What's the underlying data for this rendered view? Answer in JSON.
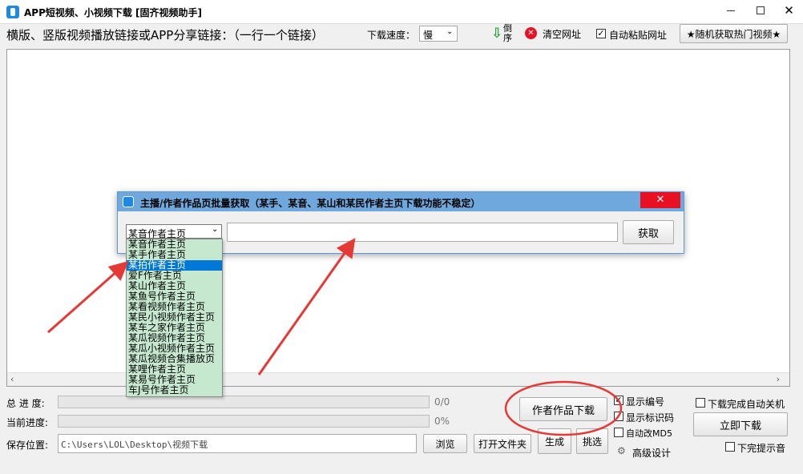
{
  "window": {
    "title": "APP短视频、小视频下载 [固齐视频助手]"
  },
  "toolbar": {
    "link_label": "横版、竖版视频播放链接或APP分享链接：（一行一个链接）",
    "speed_label": "下载速度：",
    "speed_value": "慢",
    "reverse_label": "倒序",
    "clear_label": "清空网址",
    "auto_paste_label": "自动粘贴网址",
    "auto_paste_checked": true,
    "random_hot_label": "★随机获取热门视频★"
  },
  "dialog": {
    "title": "主播/作者作品页批量获取（某手、某音、某山和某民作者主页下载功能不稳定）",
    "select_value": "某音作者主页",
    "url_value": "",
    "fetch_label": "获取",
    "options": [
      "某音作者主页",
      "某手作者主页",
      "某拍作者主页",
      "爱F作者主页",
      "某山作者主页",
      "某鱼号作者主页",
      "某看视频作者主页",
      "某民小视频作者主页",
      "某车之家作者主页",
      "某瓜视频作者主页",
      "某瓜小视频作者主页",
      "某瓜视频合集播放页",
      "某哩作者主页",
      "某易号作者主页",
      "车J号作者主页"
    ],
    "selected_option": "某拍作者主页"
  },
  "bottom": {
    "total_progress_label": "总 进 度:",
    "total_progress_text": "0/0",
    "total_progress": 0,
    "current_progress_label": "当前进度:",
    "current_progress_text": "0%",
    "current_progress": 0,
    "save_label": "保存位置:",
    "save_path": "C:\\Users\\LOL\\Desktop\\视频下载",
    "browse_label": "浏览",
    "open_folder_label": "打开文件夹",
    "author_download_label": "作者作品下载",
    "generate_label": "生成",
    "pick_label": "挑选",
    "show_number_label": "显示编号",
    "show_number_checked": true,
    "show_id_label": "显示标识码",
    "show_id_checked": false,
    "auto_md5_label": "自动改MD5",
    "auto_md5_checked": false,
    "advanced_label": "高级设计",
    "shutdown_label": "下载完成自动关机",
    "download_now_label": "立即下载",
    "finish_sound_label": "下完提示音"
  },
  "colors": {
    "accent": "#0078d7",
    "dialog_title_bg": "#6fa8dc",
    "close_red": "#e81123",
    "annotation_red": "#e53935"
  }
}
